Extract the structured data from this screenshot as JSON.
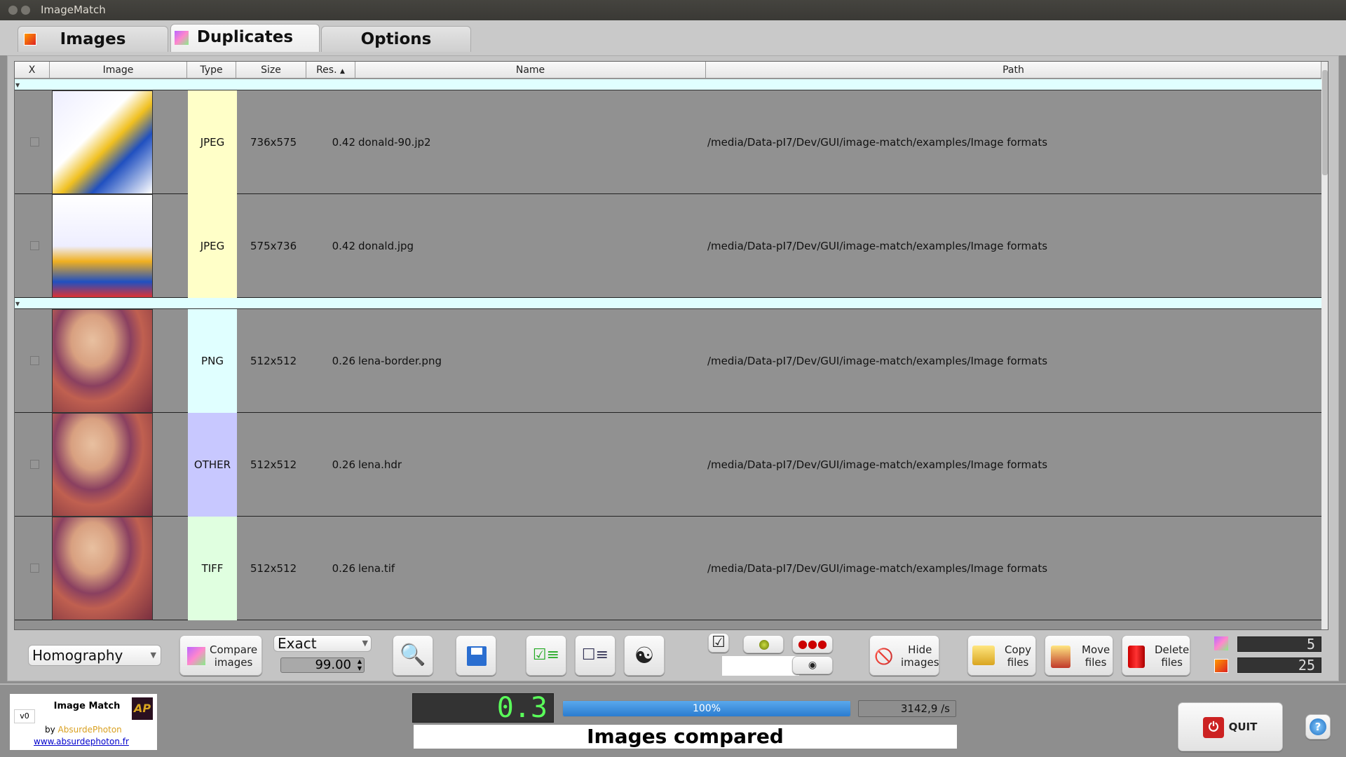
{
  "window": {
    "title": "ImageMatch"
  },
  "tabs": [
    {
      "label": "Images",
      "icon": "image-icon"
    },
    {
      "label": "Duplicates",
      "icon": "duplicates-icon",
      "active": true
    },
    {
      "label": "Options"
    }
  ],
  "table": {
    "columns": [
      "X",
      "Image",
      "Type",
      "Size",
      "Res.",
      "Name",
      "Path"
    ],
    "sort": {
      "column": "Res.",
      "direction": "ascending"
    },
    "groups": [
      {
        "rows": [
          {
            "checked": false,
            "type": "JPEG",
            "size": "736x575",
            "res": "0.42",
            "name": "donald-90.jp2",
            "path": "/media/Data-pI7/Dev/GUI/image-match/examples/Image formats",
            "type_color": "#ffffc8"
          },
          {
            "checked": false,
            "type": "JPEG",
            "size": "575x736",
            "res": "0.42",
            "name": "donald.jpg",
            "path": "/media/Data-pI7/Dev/GUI/image-match/examples/Image formats",
            "type_color": "#ffffc8"
          }
        ]
      },
      {
        "rows": [
          {
            "checked": false,
            "type": "PNG",
            "size": "512x512",
            "res": "0.26",
            "name": "lena-border.png",
            "path": "/media/Data-pI7/Dev/GUI/image-match/examples/Image formats",
            "type_color": "#e0ffff"
          },
          {
            "checked": false,
            "type": "OTHER",
            "size": "512x512",
            "res": "0.26",
            "name": "lena.hdr",
            "path": "/media/Data-pI7/Dev/GUI/image-match/examples/Image formats",
            "type_color": "#c8c8ff"
          },
          {
            "checked": false,
            "type": "TIFF",
            "size": "512x512",
            "res": "0.26",
            "name": "lena.tif",
            "path": "/media/Data-pI7/Dev/GUI/image-match/examples/Image formats",
            "type_color": "#e0ffe0"
          }
        ]
      }
    ]
  },
  "toolbar": {
    "method": "Homography",
    "compare": "Compare\nimages",
    "mode": "Exact",
    "threshold": "99.00",
    "hide": "Hide\nimages",
    "copy": "Copy\nfiles",
    "move": "Move\nfiles",
    "delete": "Delete\nfiles",
    "duplicates_count": "5",
    "images_count": "25"
  },
  "status": {
    "app_name": "Image Match",
    "version": "v0",
    "by": "by",
    "author": "AbsurdePhoton",
    "url": "www.absurdephoton.fr",
    "timer": "0.3",
    "progress": 100,
    "progress_label": "100%",
    "rate": "3142,9 /s",
    "message": "Images compared",
    "quit": "QUIT"
  },
  "colors": {
    "group_row": "#e0ffff",
    "progress": "#3a8fdc",
    "lcd": "#5aff5a"
  }
}
